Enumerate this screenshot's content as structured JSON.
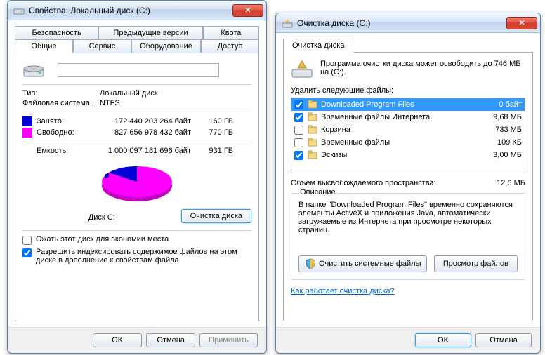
{
  "win1": {
    "title": "Свойства: Локальный диск (C:)",
    "tabs_row1": [
      "Безопасность",
      "Предыдущие версии",
      "Квота"
    ],
    "tabs_row2": [
      "Общие",
      "Сервис",
      "Оборудование",
      "Доступ"
    ],
    "active_tab": "Общие",
    "drive_label": "",
    "type_label": "Тип:",
    "type_value": "Локальный диск",
    "fs_label": "Файловая система:",
    "fs_value": "NTFS",
    "used_label": "Занято:",
    "used_bytes": "172 440 203 264 байт",
    "used_gb": "160 ГБ",
    "free_label": "Свободно:",
    "free_bytes": "827 656 978 432 байт",
    "free_gb": "770 ГБ",
    "cap_label": "Емкость:",
    "cap_bytes": "1 000 097 181 696 байт",
    "cap_gb": "931 ГБ",
    "disk_caption": "Диск C:",
    "cleanup_btn": "Очистка диска",
    "compress_chk": "Сжать этот диск для экономии места",
    "compress_checked": false,
    "index_chk": "Разрешить индексировать содержимое файлов на этом диске в дополнение к свойствам файла",
    "index_checked": true,
    "ok": "OK",
    "cancel": "Отмена",
    "apply": "Применить"
  },
  "win2": {
    "title": "Очистка диска  (C:)",
    "tab": "Очистка диска",
    "msg": "Программа очистки диска может освободить до 746 МБ на  (C:).",
    "list_header": "Удалить следующие файлы:",
    "files": [
      {
        "name": "Downloaded Program Files",
        "size": "0 байт",
        "checked": true,
        "selected": true
      },
      {
        "name": "Временные файлы Интернета",
        "size": "9,68 МБ",
        "checked": true,
        "selected": false
      },
      {
        "name": "Корзина",
        "size": "733 МБ",
        "checked": false,
        "selected": false
      },
      {
        "name": "Временные файлы",
        "size": "109 КБ",
        "checked": false,
        "selected": false
      },
      {
        "name": "Эскизы",
        "size": "3,00 МБ",
        "checked": true,
        "selected": false
      }
    ],
    "freed_label": "Объем высвобождаемого пространства:",
    "freed_value": "12,6 МБ",
    "desc_title": "Описание",
    "desc_text": "В папке \"Downloaded Program Files\" временно сохраняются элементы ActiveX и приложения Java, автоматически загружаемые из Интернета при просмотре некоторых страниц.",
    "clean_sys_btn": "Очистить системные файлы",
    "view_files_btn": "Просмотр файлов",
    "link": "Как работает очистка диска?",
    "ok": "OK",
    "cancel": "Отмена"
  },
  "chart_data": {
    "type": "pie",
    "title": "Диск C:",
    "categories": [
      "Занято",
      "Свободно"
    ],
    "values": [
      160,
      770
    ],
    "colors": [
      "#0000d4",
      "#ff00ff"
    ],
    "unit": "ГБ"
  }
}
